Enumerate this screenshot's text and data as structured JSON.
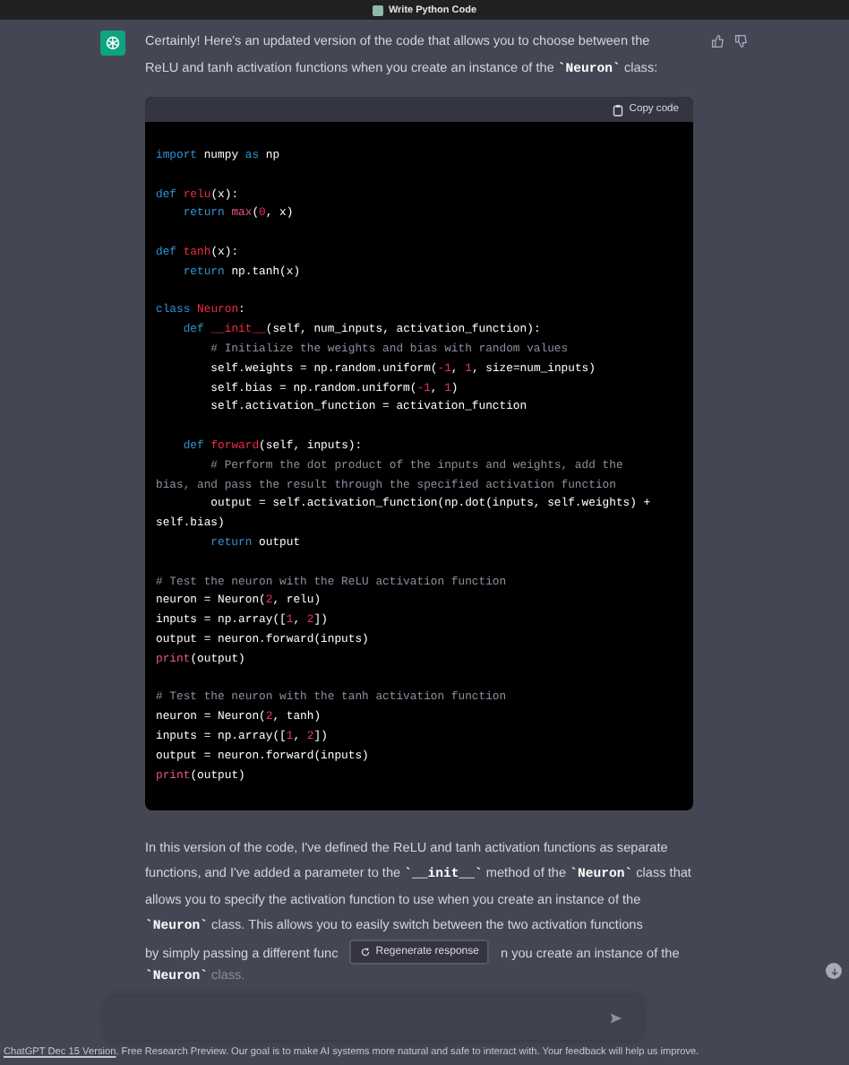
{
  "window": {
    "title": "Write Python Code"
  },
  "message": {
    "intro": "Certainly! Here's an updated version of the code that allows you to choose between the ReLU and tanh activation functions when you create an instance of the **`Neuron`** class:",
    "code_block": {
      "copy_label": "Copy code",
      "groups": [
        {
          "lines": [
            [
              {
                "kind": "keyword",
                "text": "import"
              },
              {
                "kind": "plain",
                "text": " numpy "
              },
              {
                "kind": "keyword",
                "text": "as"
              },
              {
                "kind": "plain",
                "text": " np"
              }
            ]
          ]
        },
        {
          "lines": [
            [
              {
                "kind": "keyword",
                "text": "def"
              },
              {
                "kind": "name",
                "text": " relu"
              },
              {
                "kind": "plain",
                "text": "(x):"
              }
            ],
            [
              {
                "kind": "keyword",
                "text": "    return"
              },
              {
                "kind": "builtin",
                "text": " max"
              },
              {
                "kind": "plain",
                "text": "("
              },
              {
                "kind": "number",
                "text": "0"
              },
              {
                "kind": "plain",
                "text": ", x)"
              }
            ]
          ]
        },
        {
          "lines": [
            [
              {
                "kind": "keyword",
                "text": "def"
              },
              {
                "kind": "name",
                "text": " tanh"
              },
              {
                "kind": "plain",
                "text": "(x):"
              }
            ],
            [
              {
                "kind": "keyword",
                "text": "    return"
              },
              {
                "kind": "plain",
                "text": " np.tanh(x)"
              }
            ]
          ]
        },
        {
          "lines": [
            [
              {
                "kind": "keyword",
                "text": "class"
              },
              {
                "kind": "name",
                "text": " Neuron"
              },
              {
                "kind": "plain",
                "text": ":"
              }
            ],
            [
              {
                "kind": "keyword",
                "text": "    def"
              },
              {
                "kind": "name",
                "text": " __init__"
              },
              {
                "kind": "plain",
                "text": "(self, num_inputs, activation_function):"
              }
            ],
            [
              {
                "kind": "comment",
                "text": "        # Initialize the weights and bias with random values"
              }
            ],
            [
              {
                "kind": "plain",
                "text": "        self.weights = np.random.uniform("
              },
              {
                "kind": "number",
                "text": "-1"
              },
              {
                "kind": "plain",
                "text": ", "
              },
              {
                "kind": "number",
                "text": "1"
              },
              {
                "kind": "plain",
                "text": ", size=num_inputs)"
              }
            ],
            [
              {
                "kind": "plain",
                "text": "        self.bias = np.random.uniform("
              },
              {
                "kind": "number",
                "text": "-1"
              },
              {
                "kind": "plain",
                "text": ", "
              },
              {
                "kind": "number",
                "text": "1"
              },
              {
                "kind": "plain",
                "text": ")"
              }
            ],
            [
              {
                "kind": "plain",
                "text": "        self.activation_function = activation_function"
              }
            ]
          ]
        },
        {
          "lines": [
            [
              {
                "kind": "keyword",
                "text": "    def"
              },
              {
                "kind": "name",
                "text": " forward"
              },
              {
                "kind": "plain",
                "text": "(self, inputs):"
              }
            ],
            [
              {
                "kind": "comment",
                "text": "        # Perform the dot product of the inputs and weights, add the"
              }
            ],
            [
              {
                "kind": "comment",
                "text": "bias, and pass the result through the specified activation function"
              }
            ],
            [
              {
                "kind": "plain",
                "text": "        output = self.activation_function(np.dot(inputs, self.weights) +"
              }
            ],
            [
              {
                "kind": "plain",
                "text": "self.bias)"
              }
            ],
            [
              {
                "kind": "keyword",
                "text": "        return"
              },
              {
                "kind": "plain",
                "text": " output"
              }
            ]
          ]
        },
        {
          "lines": [
            [
              {
                "kind": "comment",
                "text": "# Test the neuron with the ReLU activation function"
              }
            ],
            [
              {
                "kind": "plain",
                "text": "neuron = Neuron("
              },
              {
                "kind": "number",
                "text": "2"
              },
              {
                "kind": "plain",
                "text": ", relu)"
              }
            ],
            [
              {
                "kind": "plain",
                "text": "inputs = np.array(["
              },
              {
                "kind": "number",
                "text": "1"
              },
              {
                "kind": "plain",
                "text": ", "
              },
              {
                "kind": "number",
                "text": "2"
              },
              {
                "kind": "plain",
                "text": "])"
              }
            ],
            [
              {
                "kind": "plain",
                "text": "output = neuron.forward(inputs)"
              }
            ],
            [
              {
                "kind": "builtin",
                "text": "print"
              },
              {
                "kind": "plain",
                "text": "(output)"
              }
            ]
          ]
        },
        {
          "lines": [
            [
              {
                "kind": "comment",
                "text": "# Test the neuron with the tanh activation function"
              }
            ],
            [
              {
                "kind": "plain",
                "text": "neuron = Neuron("
              },
              {
                "kind": "number",
                "text": "2"
              },
              {
                "kind": "plain",
                "text": ", tanh)"
              }
            ],
            [
              {
                "kind": "plain",
                "text": "inputs = np.array(["
              },
              {
                "kind": "number",
                "text": "1"
              },
              {
                "kind": "plain",
                "text": ", "
              },
              {
                "kind": "number",
                "text": "2"
              },
              {
                "kind": "plain",
                "text": "])"
              }
            ],
            [
              {
                "kind": "plain",
                "text": "output = neuron.forward(inputs)"
              }
            ],
            [
              {
                "kind": "builtin",
                "text": "print"
              },
              {
                "kind": "plain",
                "text": "(output)"
              }
            ]
          ]
        }
      ]
    },
    "explanation": "In this version of the code, I've defined the ReLU and tanh activation functions as separate functions, and I've added a parameter to the **`__init__`** method of the **`Neuron`** class that allows you to specify the activation function to use when you create an instance of the **`Neuron`** class. This allows you to easily switch between the two activation functions",
    "explanation_covered_start": "by simply passing a different func",
    "explanation_covered_end": "n you create an instance of the",
    "explanation_faded": "**`Neuron`** class."
  },
  "regenerate_button": "Regenerate response",
  "footer": {
    "link": "ChatGPT Dec 15 Version",
    "text": ". Free Research Preview. Our goal is to make AI systems more natural and safe to interact with. Your feedback will help us improve."
  }
}
